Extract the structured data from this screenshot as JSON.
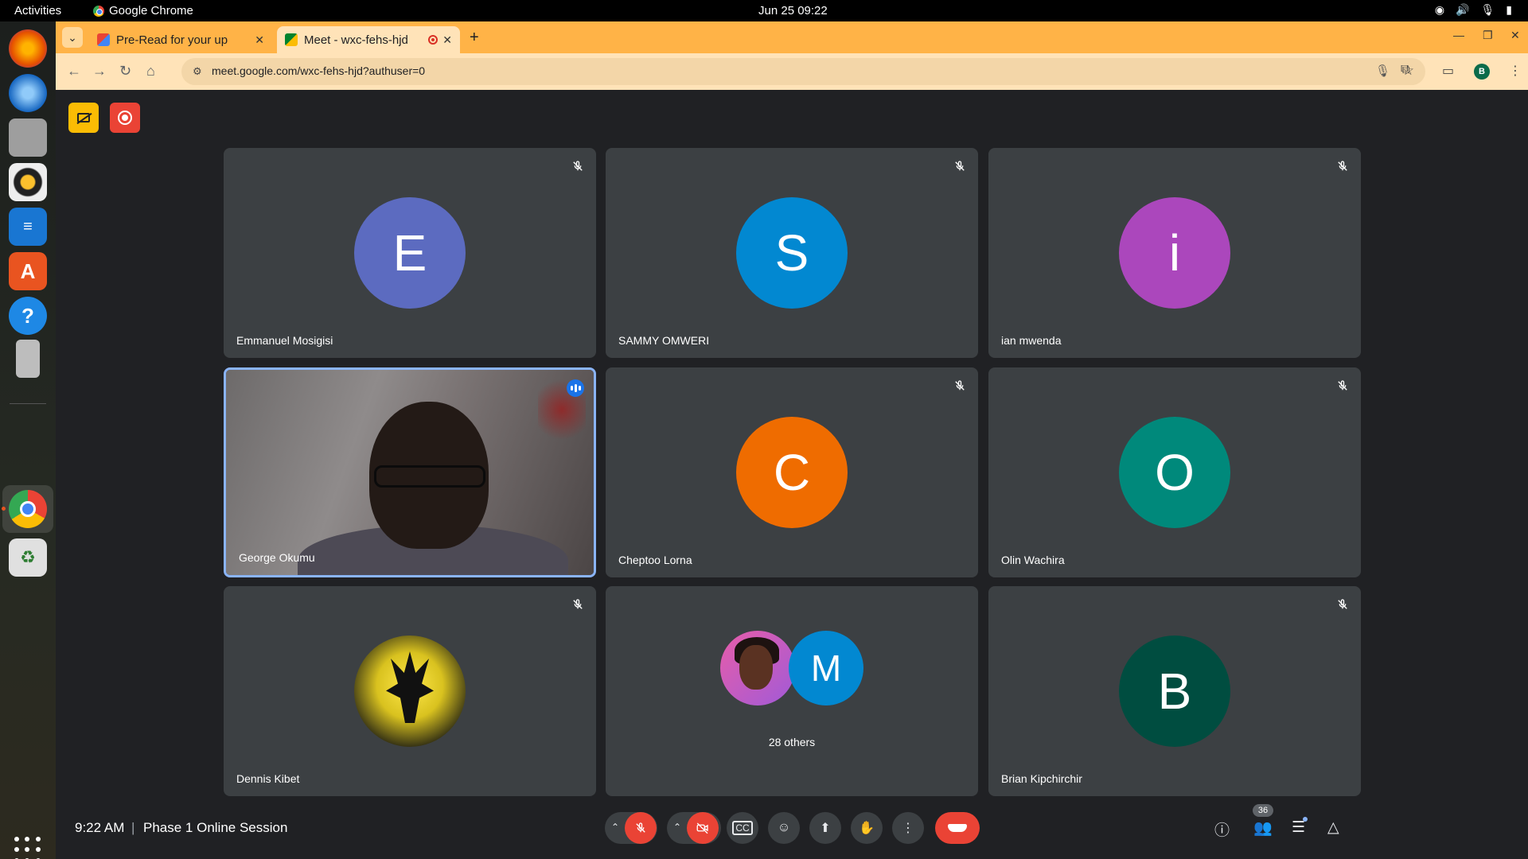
{
  "os": {
    "activities": "Activities",
    "app_name": "Google Chrome",
    "clock": "Jun 25  09:22"
  },
  "browser": {
    "tabs": [
      {
        "title": "Pre-Read for your up",
        "active": false
      },
      {
        "title": "Meet - wxc-fehs-hjd",
        "active": true
      }
    ],
    "url": "meet.google.com/wxc-fehs-hjd?authuser=0",
    "profile_initial": "B"
  },
  "meet": {
    "tiles": [
      {
        "name": "Emmanuel Mosigisi",
        "initial": "E",
        "color": "#5c6bc0",
        "muted": true
      },
      {
        "name": "SAMMY OMWERI",
        "initial": "S",
        "color": "#0288d1",
        "muted": true
      },
      {
        "name": "ian mwenda",
        "initial": "i",
        "color": "#ab47bc",
        "muted": true
      },
      {
        "name": "George Okumu",
        "initial": "",
        "color": "",
        "muted": false,
        "video": true
      },
      {
        "name": "Cheptoo Lorna",
        "initial": "C",
        "color": "#ef6c00",
        "muted": true
      },
      {
        "name": "Olin Wachira",
        "initial": "O",
        "color": "#00897b",
        "muted": true
      },
      {
        "name": "Dennis Kibet",
        "initial": "",
        "color": "",
        "muted": true
      },
      {
        "name": "",
        "initial": "M",
        "color": "#0288d1",
        "others_label": "28 others"
      },
      {
        "name": "Brian Kipchirchir",
        "initial": "B",
        "color": "#004d40",
        "muted": true
      }
    ],
    "bottom": {
      "time": "9:22 AM",
      "separator": "|",
      "meeting_name": "Phase 1 Online Session",
      "participant_count": "36"
    }
  }
}
